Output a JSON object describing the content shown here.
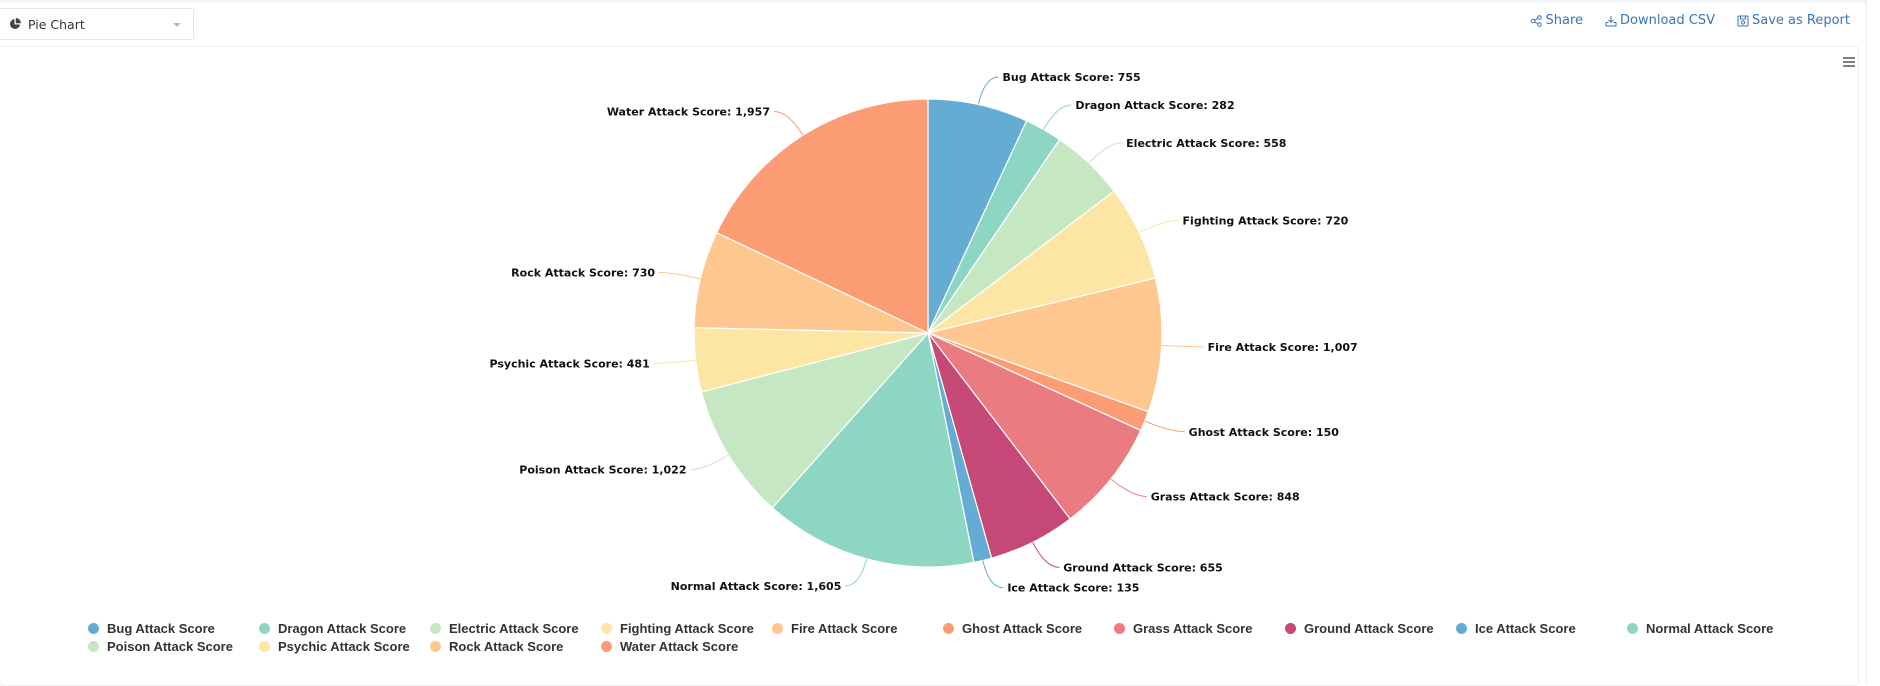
{
  "toolbar": {
    "chart_type_selected": "Pie Chart",
    "actions": [
      {
        "label": "Share",
        "icon": "share-icon"
      },
      {
        "label": "Download CSV",
        "icon": "download-icon"
      },
      {
        "label": "Save as Report",
        "icon": "save-icon"
      }
    ],
    "menu_icon": "hamburger-menu-icon"
  },
  "chart_data": {
    "type": "pie",
    "title": "",
    "label_format": "{name}: {value}",
    "legend_position": "bottom",
    "slices": [
      {
        "name": "Bug Attack Score",
        "value": 755,
        "label": "Bug Attack Score: 755",
        "color": "#64acd4"
      },
      {
        "name": "Dragon Attack Score",
        "value": 282,
        "label": "Dragon Attack Score: 282",
        "color": "#8dd6c3"
      },
      {
        "name": "Electric Attack Score",
        "value": 558,
        "label": "Electric Attack Score: 558",
        "color": "#c5e8c3"
      },
      {
        "name": "Fighting Attack Score",
        "value": 720,
        "label": "Fighting Attack Score: 720",
        "color": "#fde6a4"
      },
      {
        "name": "Fire Attack Score",
        "value": 1007,
        "label": "Fire Attack Score: 1,007",
        "color": "#fec78f"
      },
      {
        "name": "Ghost Attack Score",
        "value": 150,
        "label": "Ghost Attack Score: 150",
        "color": "#fb9c74"
      },
      {
        "name": "Grass Attack Score",
        "value": 848,
        "label": "Grass Attack Score: 848",
        "color": "#ea7b80"
      },
      {
        "name": "Ground Attack Score",
        "value": 655,
        "label": "Ground Attack Score: 655",
        "color": "#c54876"
      },
      {
        "name": "Ice Attack Score",
        "value": 135,
        "label": "Ice Attack Score: 135",
        "color": "#64acd4"
      },
      {
        "name": "Normal Attack Score",
        "value": 1605,
        "label": "Normal Attack Score: 1,605",
        "color": "#8dd6c3"
      },
      {
        "name": "Poison Attack Score",
        "value": 1022,
        "label": "Poison Attack Score: 1,022",
        "color": "#c5e8c3"
      },
      {
        "name": "Psychic Attack Score",
        "value": 481,
        "label": "Psychic Attack Score: 481",
        "color": "#fde6a4"
      },
      {
        "name": "Rock Attack Score",
        "value": 730,
        "label": "Rock Attack Score: 730",
        "color": "#fec78f"
      },
      {
        "name": "Water Attack Score",
        "value": 1957,
        "label": "Water Attack Score: 1,957",
        "color": "#fb9c74"
      }
    ]
  }
}
